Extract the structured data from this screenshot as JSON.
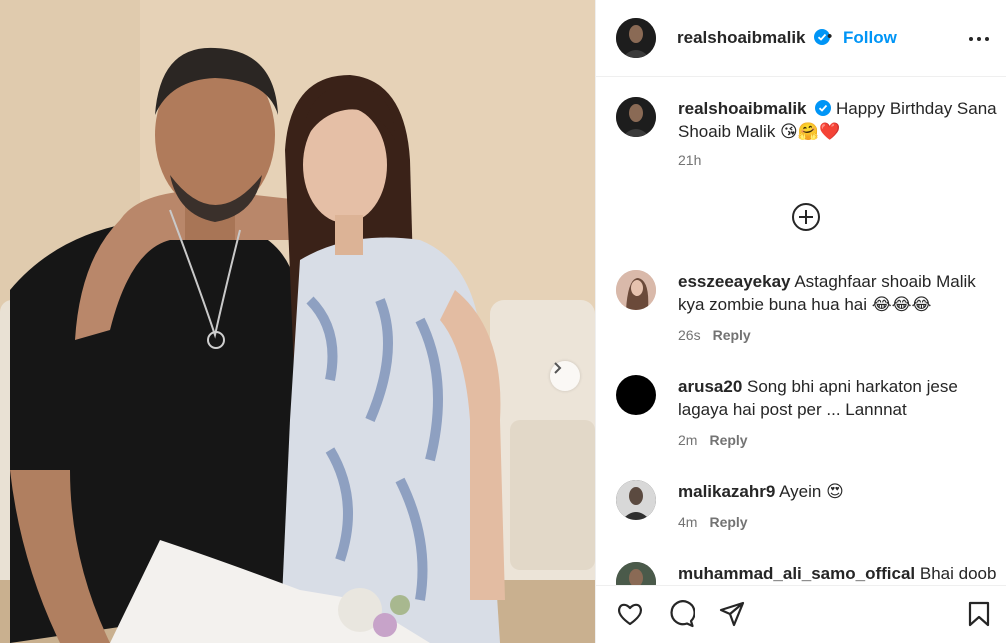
{
  "post": {
    "username": "realshoaibmalik",
    "dot": "•",
    "follow_label": "Follow",
    "caption": "Happy Birthday Sana Shoaib Malik 😘🤗❤️",
    "caption_time": "21h"
  },
  "comments": [
    {
      "username": "esszeeayekay",
      "text": "Astaghfaar shoaib Malik kya zombie buna hua hai 😂😂😂",
      "time": "26s",
      "reply": "Reply"
    },
    {
      "username": "arusa20",
      "text": "Song bhi apni harkaton jese lagaya hai post per ... Lannnat",
      "time": "2m",
      "reply": "Reply"
    },
    {
      "username": "malikazahr9",
      "text": "Ayein 😍",
      "time": "4m",
      "reply": "Reply"
    },
    {
      "username": "muhammad_ali_samo_offical",
      "text": "Bhai doob",
      "time": "",
      "reply": ""
    }
  ],
  "icons": {
    "verified": "verified-badge-icon",
    "more": "more-options-icon",
    "plus": "load-more-comments-icon",
    "like": "heart-icon",
    "comment": "comment-bubble-icon",
    "share": "paper-plane-icon",
    "save": "bookmark-icon",
    "next": "chevron-right-icon"
  },
  "colors": {
    "accent": "#0095f6",
    "verified": "#0095f6",
    "text": "#262626",
    "muted": "#737373"
  }
}
